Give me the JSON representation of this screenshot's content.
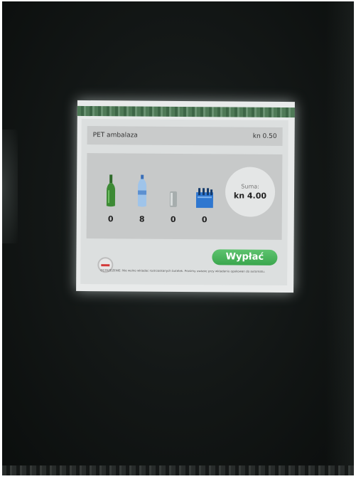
{
  "screen": {
    "product_label": "PET ambalaza",
    "unit_price": "kn 0.50",
    "items": [
      {
        "icon": "glass-bottle-icon",
        "count": "0"
      },
      {
        "icon": "plastic-bottle-icon",
        "count": "8"
      },
      {
        "icon": "can-icon",
        "count": "0"
      },
      {
        "icon": "crate-icon",
        "count": "0"
      }
    ],
    "sum_label": "Suma:",
    "sum_value": "kn 4.00",
    "pay_label": "Wypłać",
    "warning_text": "OSTRZEZENIE: Nie wolno wkladac roztrzaskanych butelek. Prosimy uwazac przy wkladaniu opakowan do automatu."
  },
  "colors": {
    "pay_button": "#3aa64d",
    "cancel_mark": "#d43a3a",
    "background": "#141817"
  }
}
